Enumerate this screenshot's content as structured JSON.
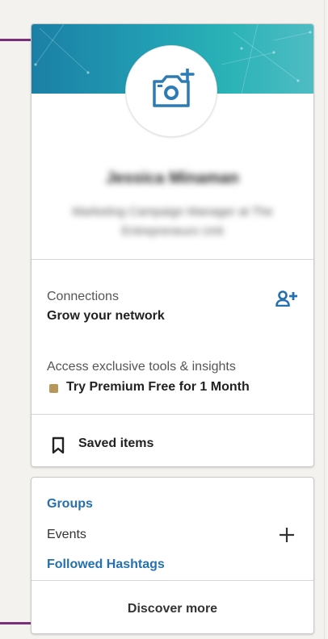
{
  "profile": {
    "name": "Jessica Minaman",
    "headline": "Marketing Campaign Manager at The Entrepreneurs Unit",
    "avatar_icon": "camera-add-icon",
    "banner_color": "#22a0b4"
  },
  "connections": {
    "label": "Connections",
    "sub_label": "Grow your network",
    "add_icon": "add-connection-icon"
  },
  "premium": {
    "label": "Access exclusive tools & insights",
    "cta": "Try Premium Free for 1 Month",
    "icon": "premium-gold-icon",
    "accent": "#b8975a"
  },
  "saved": {
    "label": "Saved items",
    "icon": "bookmark-icon"
  },
  "community": {
    "groups": "Groups",
    "events": "Events",
    "hashtags": "Followed Hashtags",
    "add_icon": "plus-icon",
    "discover": "Discover more",
    "link_color": "#2470b0"
  }
}
